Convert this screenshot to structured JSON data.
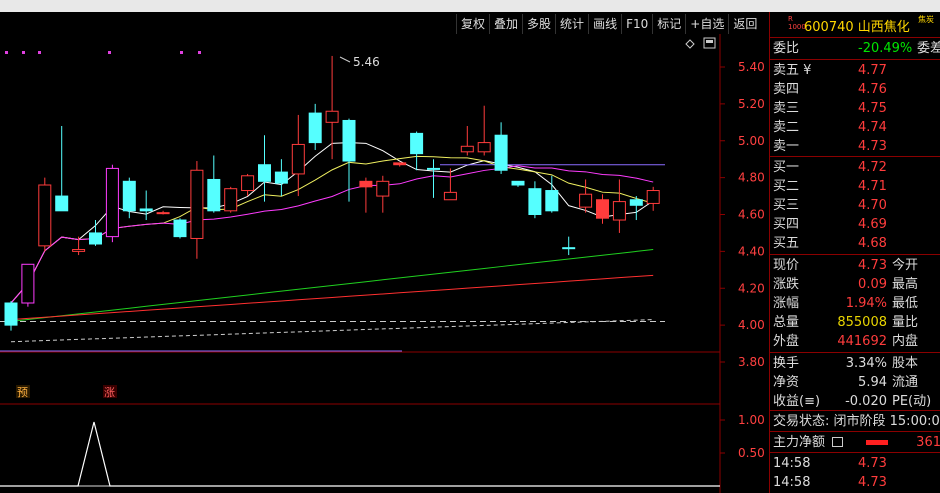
{
  "toolbar": [
    "复权",
    "叠加",
    "多股",
    "统计",
    "画线",
    "F10",
    "标记",
    "+自选",
    "返回"
  ],
  "stock": {
    "badge": "R\n1000",
    "code_name": "600740 山西焦化",
    "tag": "焦炭"
  },
  "commission": {
    "label": "委比",
    "value": "-20.49%",
    "label2": "委差"
  },
  "asks": [
    {
      "label": "卖五 ¥",
      "price": "4.77"
    },
    {
      "label": "卖四",
      "price": "4.76"
    },
    {
      "label": "卖三",
      "price": "4.75"
    },
    {
      "label": "卖二",
      "price": "4.74"
    },
    {
      "label": "卖一",
      "price": "4.73"
    }
  ],
  "bids": [
    {
      "label": "买一",
      "price": "4.72"
    },
    {
      "label": "买二",
      "price": "4.71"
    },
    {
      "label": "买三",
      "price": "4.70"
    },
    {
      "label": "买四",
      "price": "4.69"
    },
    {
      "label": "买五",
      "price": "4.68"
    }
  ],
  "quote": [
    {
      "label": "现价",
      "value": "4.73",
      "label2": "今开",
      "color": "red"
    },
    {
      "label": "涨跌",
      "value": "0.09",
      "label2": "最高",
      "color": "red"
    },
    {
      "label": "涨幅",
      "value": "1.94%",
      "label2": "最低",
      "color": "red"
    },
    {
      "label": "总量",
      "value": "855008",
      "label2": "量比",
      "color": "yellow"
    },
    {
      "label": "外盘",
      "value": "441692",
      "label2": "内盘",
      "color": "red"
    }
  ],
  "stats": [
    {
      "label": "换手",
      "value": "3.34%",
      "label2": "股本"
    },
    {
      "label": "净资",
      "value": "5.94",
      "label2": "流通"
    },
    {
      "label": "收益(≡)",
      "value": "-0.020",
      "label2": "PE(动)"
    }
  ],
  "trade_status": "交易状态: 闭市阶段 15:00:0",
  "main_net": {
    "label": "主力净额",
    "icon": "table-icon",
    "value": "361"
  },
  "ticks": [
    {
      "time": "14:58",
      "price": "4.73"
    },
    {
      "time": "14:58",
      "price": "4.73"
    }
  ],
  "chart_data": {
    "type": "candlestick",
    "y_ticks": [
      "5.40",
      "5.20",
      "5.00",
      "4.80",
      "4.60",
      "4.40",
      "4.20",
      "4.00",
      "3.80"
    ],
    "ylim": [
      3.8,
      5.4
    ],
    "high_label": "5.46",
    "signal_labels": [
      "预",
      "涨"
    ],
    "indicator_ticks": [
      "1.00",
      "0.50"
    ],
    "candles": [
      {
        "o": 4.0,
        "c": 4.12,
        "h": 4.13,
        "l": 3.97,
        "hl": "cyan"
      },
      {
        "o": 4.12,
        "c": 4.33,
        "h": 4.33,
        "l": 4.1,
        "hl": "magenta"
      },
      {
        "o": 4.43,
        "c": 4.76,
        "h": 4.8,
        "l": 4.4,
        "hl": "red"
      },
      {
        "o": 4.62,
        "c": 4.7,
        "h": 5.08,
        "l": 4.62,
        "hl": "cyan"
      },
      {
        "o": 4.4,
        "c": 4.41,
        "h": 4.48,
        "l": 4.38,
        "hl": "red"
      },
      {
        "o": 4.44,
        "c": 4.5,
        "h": 4.57,
        "l": 4.43,
        "hl": "cyan"
      },
      {
        "o": 4.48,
        "c": 4.85,
        "h": 4.87,
        "l": 4.45,
        "hl": "magenta"
      },
      {
        "o": 4.78,
        "c": 4.62,
        "h": 4.8,
        "l": 4.58,
        "hl": "cyan"
      },
      {
        "o": 4.62,
        "c": 4.63,
        "h": 4.73,
        "l": 4.57,
        "hl": "cyan"
      },
      {
        "o": 4.61,
        "c": 4.61,
        "h": 4.62,
        "l": 4.6,
        "hl": "red"
      },
      {
        "o": 4.57,
        "c": 4.48,
        "h": 4.58,
        "l": 4.47,
        "hl": "cyan"
      },
      {
        "o": 4.47,
        "c": 4.84,
        "h": 4.89,
        "l": 4.36,
        "hl": "red"
      },
      {
        "o": 4.79,
        "c": 4.62,
        "h": 4.92,
        "l": 4.61,
        "hl": "cyan"
      },
      {
        "o": 4.62,
        "c": 4.74,
        "h": 4.75,
        "l": 4.61,
        "hl": "red"
      },
      {
        "o": 4.73,
        "c": 4.81,
        "h": 4.82,
        "l": 4.7,
        "hl": "red"
      },
      {
        "o": 4.78,
        "c": 4.87,
        "h": 5.03,
        "l": 4.67,
        "hl": "cyan"
      },
      {
        "o": 4.83,
        "c": 4.77,
        "h": 4.9,
        "l": 4.7,
        "hl": "cyan"
      },
      {
        "o": 4.82,
        "c": 4.98,
        "h": 5.14,
        "l": 4.7,
        "hl": "red"
      },
      {
        "o": 4.99,
        "c": 5.15,
        "h": 5.2,
        "l": 4.95,
        "hl": "cyan"
      },
      {
        "o": 5.1,
        "c": 5.16,
        "h": 5.46,
        "l": 4.9,
        "hl": "red"
      },
      {
        "o": 5.11,
        "c": 4.89,
        "h": 5.12,
        "l": 4.67,
        "hl": "cyan"
      },
      {
        "o": 4.78,
        "c": 4.75,
        "h": 4.8,
        "l": 4.61,
        "hl": "red"
      },
      {
        "o": 4.7,
        "c": 4.78,
        "h": 4.81,
        "l": 4.61,
        "hl": "red"
      },
      {
        "o": 4.88,
        "c": 4.87,
        "h": 4.88,
        "l": 4.86,
        "hl": "red"
      },
      {
        "o": 5.04,
        "c": 4.93,
        "h": 5.05,
        "l": 4.84,
        "hl": "cyan"
      },
      {
        "o": 4.85,
        "c": 4.85,
        "h": 4.9,
        "l": 4.69,
        "hl": "cyan"
      },
      {
        "o": 4.68,
        "c": 4.72,
        "h": 4.85,
        "l": 4.68,
        "hl": "red"
      },
      {
        "o": 4.94,
        "c": 4.97,
        "h": 5.08,
        "l": 4.92,
        "hl": "red"
      },
      {
        "o": 4.94,
        "c": 4.99,
        "h": 5.19,
        "l": 4.92,
        "hl": "red"
      },
      {
        "o": 5.03,
        "c": 4.84,
        "h": 5.1,
        "l": 4.82,
        "hl": "cyan"
      },
      {
        "o": 4.78,
        "c": 4.76,
        "h": 4.78,
        "l": 4.75,
        "hl": "cyan"
      },
      {
        "o": 4.74,
        "c": 4.6,
        "h": 4.78,
        "l": 4.58,
        "hl": "cyan"
      },
      {
        "o": 4.73,
        "c": 4.62,
        "h": 4.81,
        "l": 4.61,
        "hl": "cyan"
      },
      {
        "o": 4.42,
        "c": 4.42,
        "h": 4.48,
        "l": 4.38,
        "hl": "cyan"
      },
      {
        "o": 4.64,
        "c": 4.71,
        "h": 4.79,
        "l": 4.61,
        "hl": "red"
      },
      {
        "o": 4.68,
        "c": 4.58,
        "h": 4.71,
        "l": 4.55,
        "hl": "red"
      },
      {
        "o": 4.57,
        "c": 4.67,
        "h": 4.79,
        "l": 4.5,
        "hl": "red"
      },
      {
        "o": 4.65,
        "c": 4.68,
        "h": 4.7,
        "l": 4.57,
        "hl": "cyan"
      },
      {
        "o": 4.66,
        "c": 4.73,
        "h": 4.75,
        "l": 4.62,
        "hl": "red"
      }
    ]
  }
}
